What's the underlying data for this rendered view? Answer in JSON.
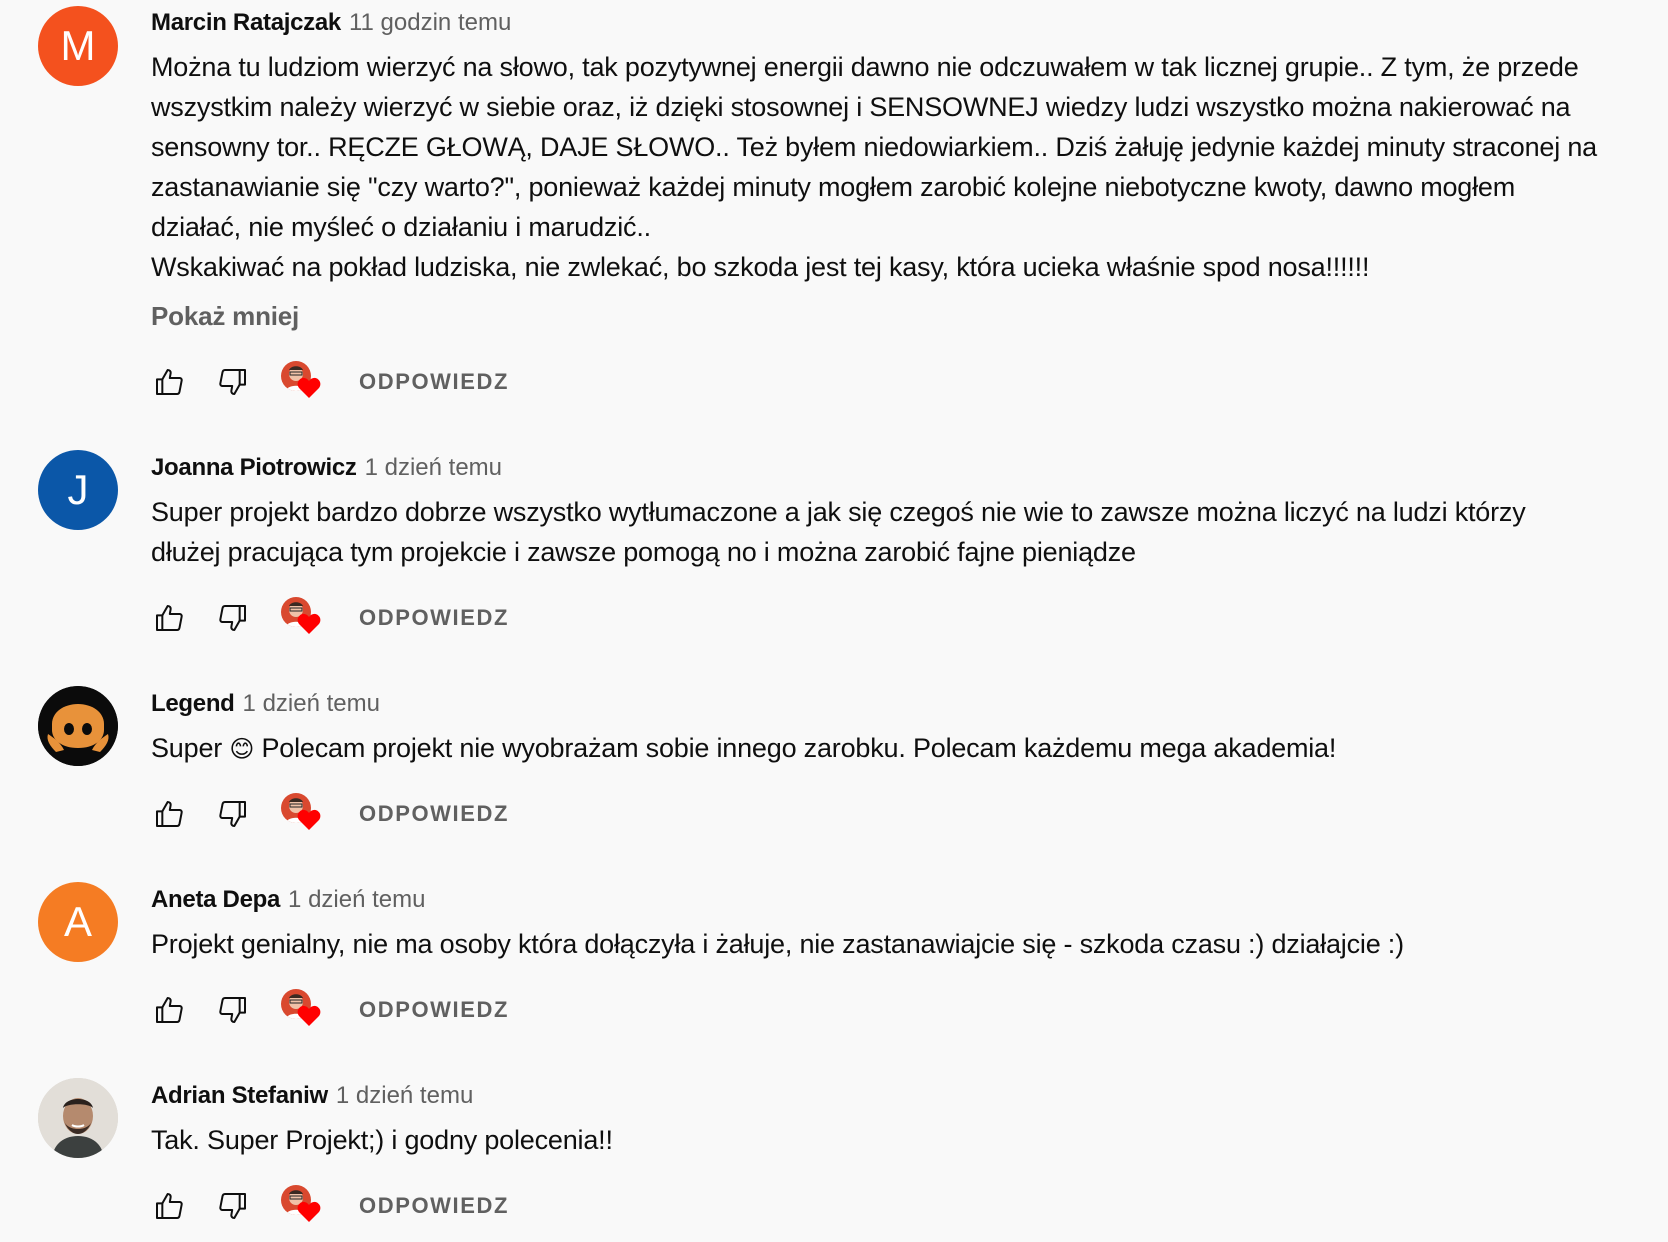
{
  "comments": [
    {
      "author": "Marcin Ratajczak",
      "time": "11 godzin temu",
      "avatar_letter": "M",
      "avatar_color": "#f4511e",
      "text_lines": [
        "Można tu ludziom wierzyć na słowo, tak pozytywnej energii dawno nie odczuwałem w tak licznej grupie.. Z tym, że przede",
        "wszystkim należy wierzyć w siebie oraz, iż dzięki stosownej i SENSOWNEJ wiedzy ludzi wszystko można nakierować na",
        "sensowny tor.. RĘCZE GŁOWĄ, DAJE SŁOWO.. Też byłem niedowiarkiem.. Dziś żałuję jedynie każdej minuty straconej na",
        "zastanawianie się \"czy warto?\", ponieważ każdej minuty mogłem zarobić kolejne niebotyczne kwoty, dawno mogłem",
        "działać, nie myśleć o działaniu i marudzić..",
        "Wskakiwać na pokład ludziska, nie zwlekać, bo szkoda jest tej kasy, która ucieka właśnie spod nosa!!!!!!"
      ],
      "show_less": "Pokaż mniej",
      "reply": "ODPOWIEDZ"
    },
    {
      "author": "Joanna Piotrowicz",
      "time": "1 dzień temu",
      "avatar_letter": "J",
      "avatar_color": "#0b57a8",
      "text_lines": [
        "Super projekt bardzo dobrze wszystko wytłumaczone a jak się czegoś nie wie to zawsze można liczyć na ludzi którzy",
        "dłużej pracująca tym projekcie i zawsze pomogą no i można zarobić fajne pieniądze"
      ],
      "reply": "ODPOWIEDZ"
    },
    {
      "author": "Legend",
      "time": "1 dzień temu",
      "text_before_emoji": "Super ",
      "emoji": "😊",
      "text_after_emoji": " Polecam projekt nie wyobrażam sobie innego zarobku. Polecam każdemu mega akademia!",
      "reply": "ODPOWIEDZ"
    },
    {
      "author": "Aneta Depa",
      "time": "1 dzień temu",
      "avatar_letter": "A",
      "avatar_color": "#f57c23",
      "text_lines": [
        "Projekt genialny, nie ma osoby która dołączyła i żałuje, nie zastanawiajcie się - szkoda czasu :) działajcie :)"
      ],
      "reply": "ODPOWIEDZ"
    },
    {
      "author": "Adrian Stefaniw",
      "time": "1 dzień temu",
      "text_lines": [
        "Tak. Super Projekt;) i godny polecenia!!"
      ],
      "reply": "ODPOWIEDZ"
    }
  ],
  "colors": {
    "heart": "#ff0000",
    "icon_stroke": "#0f0f0f",
    "muted_text": "#606060"
  }
}
